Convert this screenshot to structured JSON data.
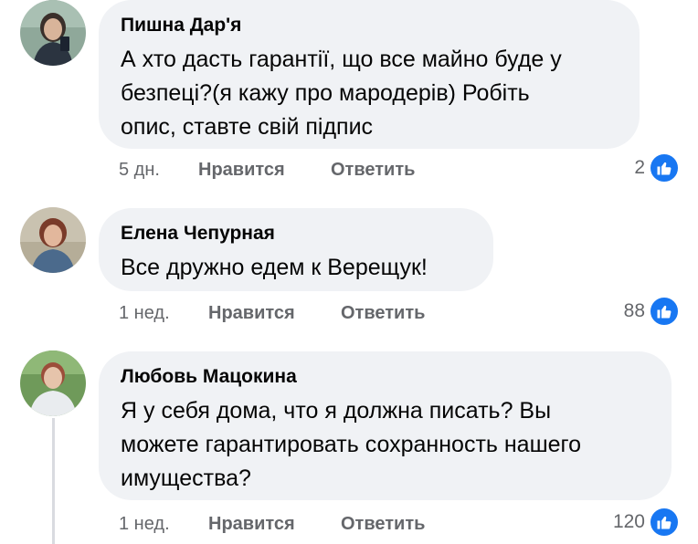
{
  "comments": [
    {
      "author": "Пишна Дар'я",
      "lines": [
        "А хто дасть гарантії, що все майно буде у",
        "безпеці?(я кажу про мародерів) Робіть",
        "опис, ставте свій підпис"
      ],
      "time": "5 дн.",
      "like_label": "Нравится",
      "reply_label": "Ответить",
      "reactions": "2",
      "avatar_colors": {
        "bg": "#8fa89a",
        "hair": "#3a2f2a",
        "skin": "#d8b49a",
        "cloth": "#2b3440"
      }
    },
    {
      "author": "Елена Чепурная",
      "lines": [
        "Все дружно едем к Верещук!"
      ],
      "time": "1 нед.",
      "like_label": "Нравится",
      "reply_label": "Ответить",
      "reactions": "88",
      "avatar_colors": {
        "bg": "#c9c2b0",
        "hair": "#7a3b2a",
        "skin": "#e2b79c",
        "cloth": "#4b6a8c"
      }
    },
    {
      "author": "Любовь Мацокина",
      "lines": [
        "Я у себя дома, что я должна писать? Вы",
        "можете гарантировать сохранность нашего",
        "имущества?"
      ],
      "time": "1 нед.",
      "like_label": "Нравится",
      "reply_label": "Ответить",
      "reactions": "120",
      "avatar_colors": {
        "bg": "#6f9a5a",
        "hair": "#9c4e3a",
        "skin": "#e6c4ab",
        "cloth": "#e9ecef"
      }
    }
  ],
  "like_icon": "thumbs-up-icon",
  "accent": "#1877f2"
}
